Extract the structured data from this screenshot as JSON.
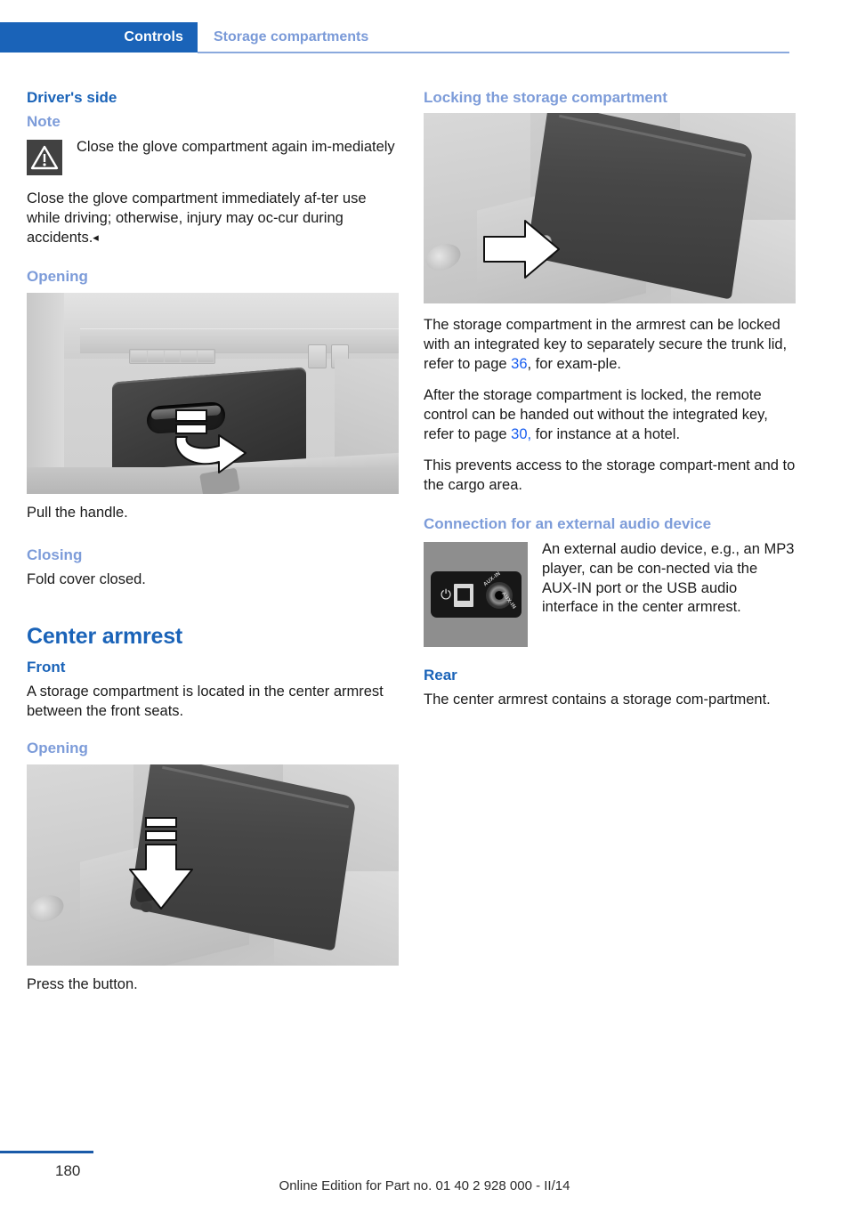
{
  "header": {
    "tab_label": "Controls",
    "section_label": "Storage compartments"
  },
  "left_column": {
    "heading_drivers_side": "Driver's side",
    "note_heading": "Note",
    "note_icon_title": "warning-triangle",
    "note_bold_text": "Close the glove compartment again im‐mediately",
    "note_body": "Close the glove compartment immediately af‐ter use while driving; otherwise, injury may oc‐cur during accidents.",
    "note_end_mark": "◂",
    "opening_heading": "Opening",
    "opening_figure_alt": "glove-compartment-handle-photo",
    "opening_caption": "Pull the handle.",
    "closing_heading": "Closing",
    "closing_body": "Fold cover closed.",
    "center_armrest_heading": "Center armrest",
    "front_heading": "Front",
    "front_body": "A storage compartment is located in the center armrest between the front seats.",
    "armrest_opening_heading": "Opening",
    "armrest_figure_alt": "center-armrest-button-photo",
    "armrest_caption": "Press the button."
  },
  "right_column": {
    "locking_heading": "Locking the storage compartment",
    "locking_figure_alt": "armrest-lock-photo",
    "locking_para1_before": "The storage compartment in the armrest can be locked with an integrated key to separately secure the trunk lid, refer to page ",
    "locking_para1_link": "36",
    "locking_para1_after": ", for exam‐ple.",
    "locking_para2_before": "After the storage compartment is locked, the remote control can be handed out without the integrated key, refer to page ",
    "locking_para2_link": "30,",
    "locking_para2_after": " for instance at a hotel.",
    "locking_para3": "This prevents access to the storage compart‐ment and to the cargo area.",
    "audio_heading": "Connection for an external audio device",
    "audio_figure_alt": "usb-aux-in-ports-photo",
    "usb_icon_name": "usb-icon",
    "aux_label_1": "AUX-IN",
    "aux_label_2": "AUX-IN",
    "audio_body": "An external audio device, e.g., an MP3 player, can be con‐nected via the AUX-IN port or the USB audio interface in the center armrest.",
    "rear_heading": "Rear",
    "rear_body": "The center armrest contains a storage com‐partment."
  },
  "footer": {
    "page_number": "180",
    "edition_text": "Online Edition for Part no. 01 40 2 928 000 - II/14"
  },
  "colors": {
    "tab_blue": "#1a63b8",
    "heading_blue": "#1a63b8",
    "subheading_blue": "#7d9cd9",
    "link_blue": "#1a5ff0",
    "rule_blue": "#8aa9dd",
    "footer_rule_blue": "#1a5aa8",
    "warn_icon_bg": "#414141"
  }
}
